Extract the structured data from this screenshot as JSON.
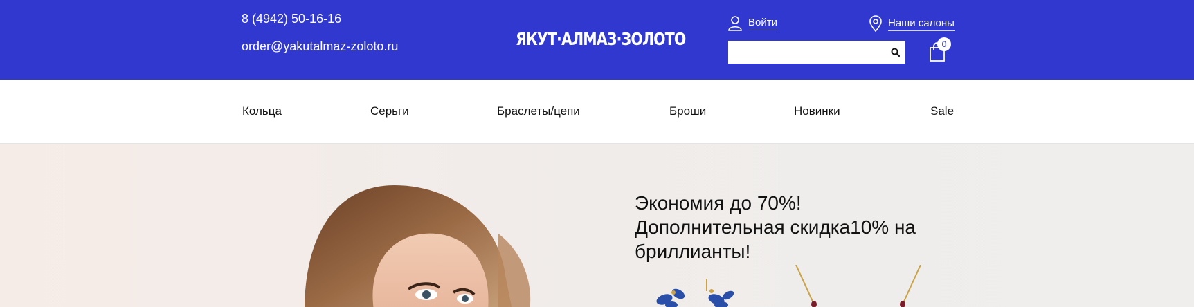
{
  "header": {
    "phone": "8 (4942) 50-16-16",
    "email": "order@yakutalmaz-zoloto.ru",
    "logo_text": "ЯКУТ·АЛМАЗ·ЗОЛОТО",
    "login_label": "Войти",
    "salons_label": "Наши салоны",
    "search_placeholder": "",
    "cart_count": "0",
    "icons": {
      "login": "user-icon",
      "salons": "map-pin-icon",
      "search": "search-icon",
      "cart": "shopping-bag-icon"
    },
    "brand_color": "#3038d0"
  },
  "nav": {
    "items": [
      {
        "label": "Кольца"
      },
      {
        "label": "Серьги"
      },
      {
        "label": "Браслеты/цепи"
      },
      {
        "label": "Броши"
      },
      {
        "label": "Новинки"
      },
      {
        "label": "Sale"
      }
    ]
  },
  "hero": {
    "title_lines": [
      "Экономия до 70%!",
      "Дополнительная скидка10% на",
      "бриллианты!"
    ]
  }
}
